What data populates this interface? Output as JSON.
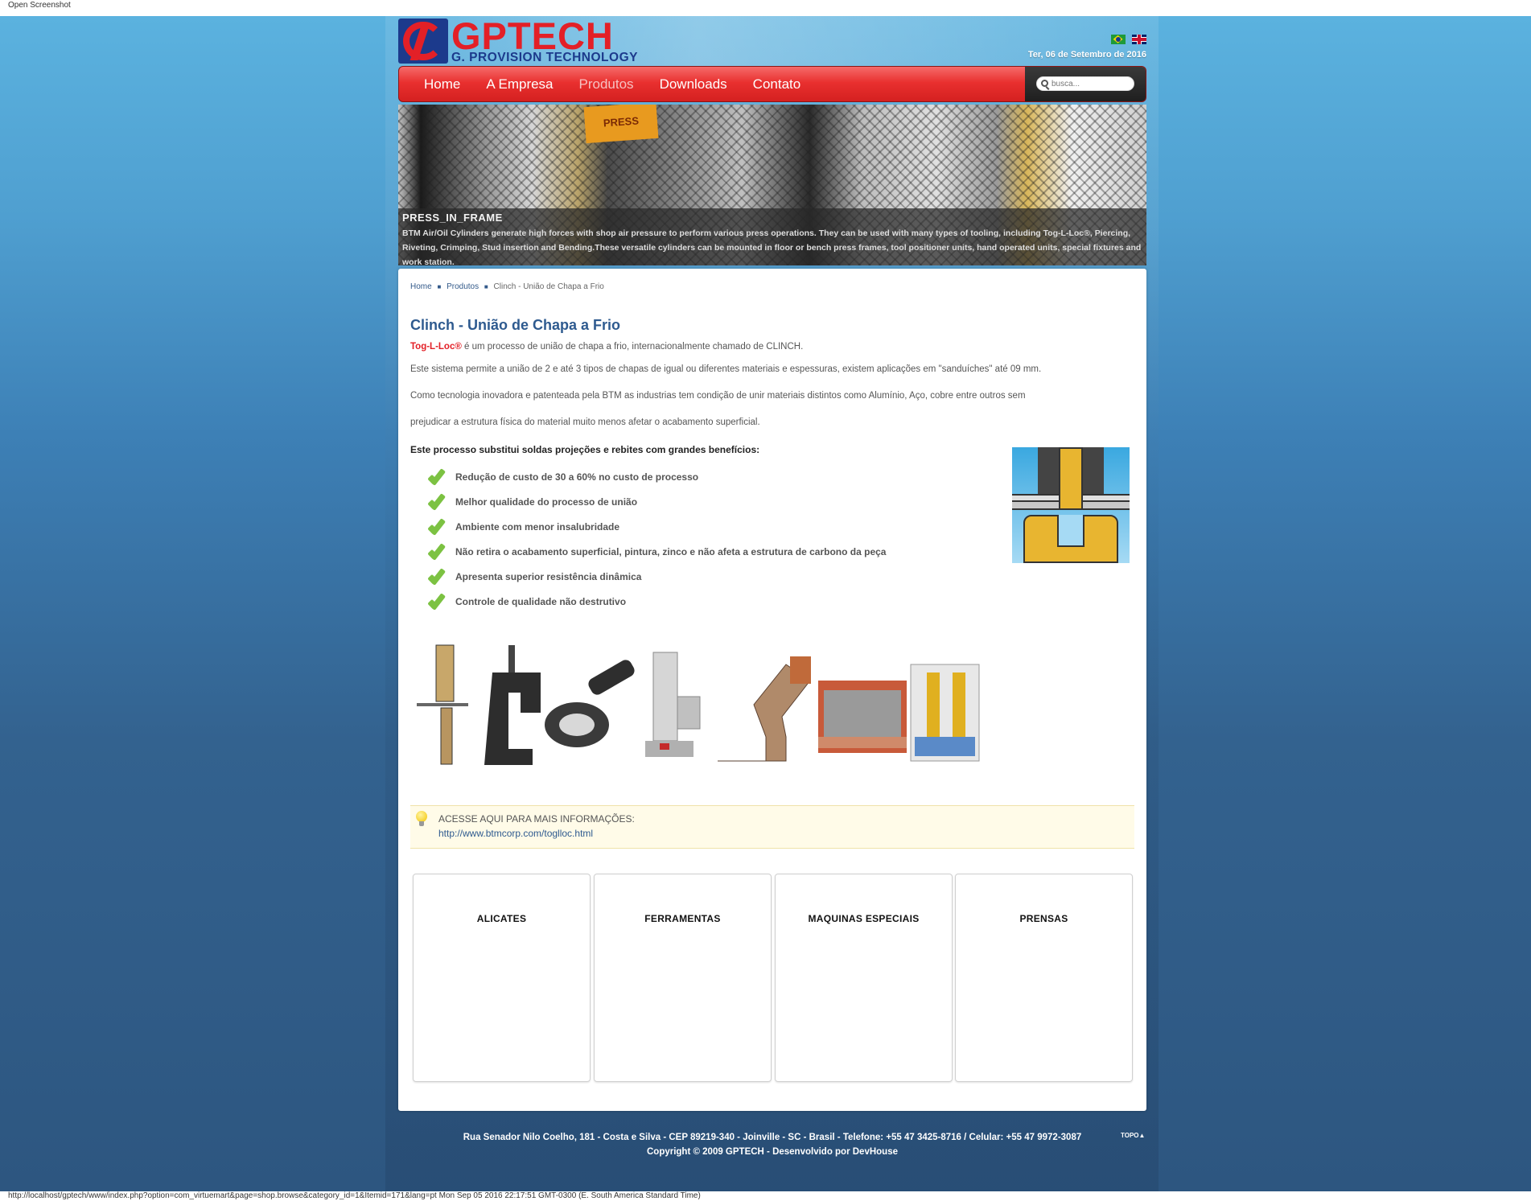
{
  "window": {
    "title_bar": "Open Screenshot",
    "status_url": "http://localhost/gptech/www/index.php?option=com_virtuemart&page=shop.browse&category_id=1&Itemid=171&lang=pt Mon Sep 05 2016 22:17:51 GMT-0300 (E. South America Standard Time)"
  },
  "header": {
    "logo_text": "GPTECH",
    "logo_sub": "G. PROVISION TECHNOLOGY",
    "date": "Ter, 06 de Setembro de 2016",
    "flags": [
      "brazil-flag-icon",
      "uk-flag-icon"
    ]
  },
  "nav": {
    "items": [
      "Home",
      "A Empresa",
      "Produtos",
      "Downloads",
      "Contato"
    ],
    "active": "Produtos",
    "search_placeholder": "busca..."
  },
  "banner": {
    "sign_text": "PRESS",
    "title": "PRESS_IN_FRAME",
    "text": "BTM Air/Oil Cylinders generate high forces with shop air pressure to perform various press operations. They can be used with many types of tooling, including Tog-L-Loc®, Piercing, Riveting, Crimping, Stud insertion and Bending.These versatile cylinders can be mounted in floor or bench press frames, tool positioner units, hand operated units, special fixtures and work station."
  },
  "breadcrumb": {
    "items": [
      "Home",
      "Produtos"
    ],
    "current": "Clinch - União de Chapa a Frio"
  },
  "page": {
    "title": "Clinch - União de Chapa a Frio",
    "intro_brand": "Tog-L-Loc®",
    "intro_rest": " é um processo de união de chapa a frio, internacionalmente chamado de CLINCH.",
    "p1": "Este sistema permite a união de 2 e até 3 tipos de chapas de igual ou diferentes materiais e espessuras, existem aplicações em \"sanduíches\" até 09 mm.",
    "p2": "Como tecnologia inovadora e patenteada pela BTM as industrias tem condição de unir materiais distintos como Alumínio, Aço, cobre  entre  outros  sem",
    "p3": "prejudicar a estrutura física do material muito menos afetar o acabamento superficial.",
    "benefits_title": "Este processo substitui soldas projeções e rebites com grandes benefícios:",
    "benefits": [
      "Redução de custo de 30 a 60% no custo de processo",
      "Melhor qualidade do processo de união",
      "Ambiente com menor insalubridade",
      "Não  retira o acabamento superficial, pintura, zinco e não afeta a estrutura de carbono da peça",
      "Apresenta superior resistência dinâmica",
      "Controle de qualidade não destrutivo"
    ]
  },
  "info": {
    "title": "ACESSE AQUI PARA MAIS INFORMAÇÕES:",
    "link": "http://www.btmcorp.com/toglloc.html"
  },
  "categories": [
    "ALICATES",
    "FERRAMENTAS",
    "MAQUINAS ESPECIAIS",
    "PRENSAS"
  ],
  "footer": {
    "line1": "Rua Senador Nilo Coelho, 181 - Costa e Silva - CEP 89219-340 - Joinville - SC - Brasil - Telefone: +55 47 3425-8716 / Celular: +55 47 9972-3087",
    "line2": "Copyright © 2009 GPTECH - Desenvolvido por DevHouse",
    "topo": "TOPO▲"
  },
  "colors": {
    "brand_red": "#e32027",
    "brand_blue": "#1c3a8c",
    "link_blue": "#2e5a8f",
    "check_green": "#7cc242"
  }
}
